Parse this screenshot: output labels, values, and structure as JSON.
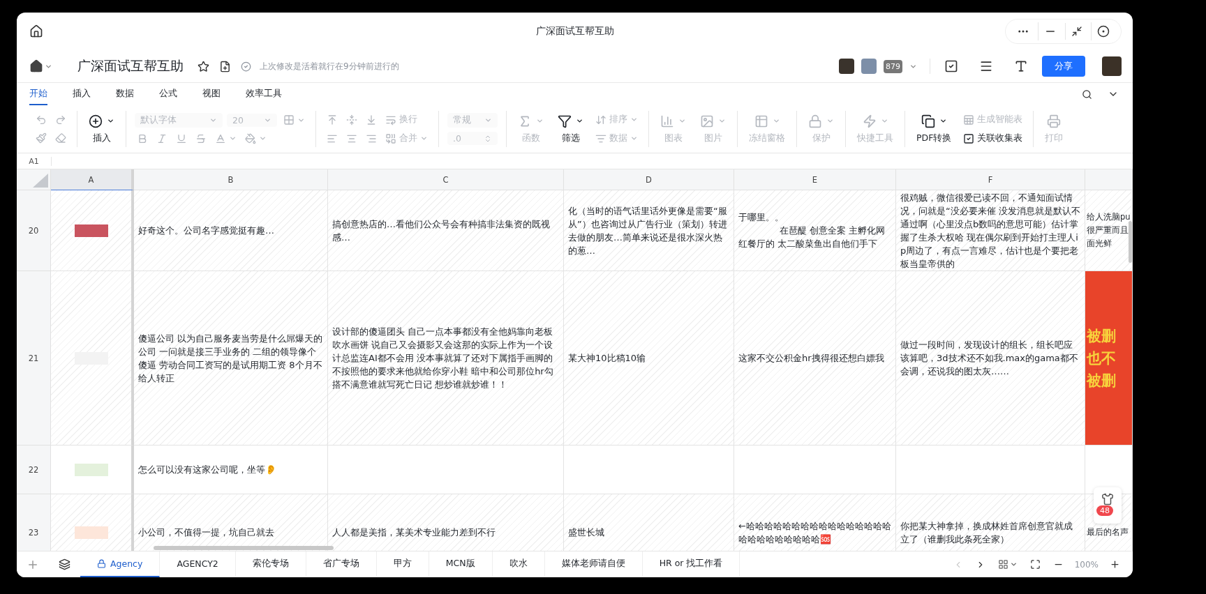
{
  "window": {
    "title": "广深面试互帮互助"
  },
  "header": {
    "doc_title": "广深面试互帮互助",
    "last_edit": "上次修改是活着就行在9分钟前进行的",
    "collaborator_count": "879",
    "share": "分享"
  },
  "menu_tabs": [
    {
      "label": "开始",
      "selected": true
    },
    {
      "label": "插入",
      "selected": false
    },
    {
      "label": "数据",
      "selected": false
    },
    {
      "label": "公式",
      "selected": false
    },
    {
      "label": "视图",
      "selected": false
    },
    {
      "label": "效率工具",
      "selected": false
    }
  ],
  "ribbon": [
    [
      {
        "rows": [
          [
            {
              "kind": "undo",
              "disabled": true
            },
            {
              "kind": "redo",
              "disabled": true
            }
          ],
          [
            {
              "kind": "painter",
              "disabled": true
            },
            {
              "kind": "eraser",
              "disabled": true
            }
          ]
        ]
      }
    ],
    [
      {
        "items": [
          {
            "kind": "insert",
            "label": "插入",
            "dropdown": true,
            "disabled": false
          }
        ]
      }
    ],
    [
      {
        "rows": [
          [
            {
              "kind": "select",
              "value": "默认字体",
              "disabled": true
            },
            {
              "kind": "select",
              "value": "20",
              "disabled": true
            },
            {
              "kind": "borders",
              "dropdown": true,
              "disabled": true
            }
          ],
          [
            {
              "kind": "bold",
              "disabled": true
            },
            {
              "kind": "italic",
              "disabled": true
            },
            {
              "kind": "underline",
              "disabled": true
            },
            {
              "kind": "strike",
              "disabled": true
            },
            {
              "kind": "font_color",
              "dropdown": true,
              "disabled": true
            },
            {
              "kind": "fill_color",
              "dropdown": true,
              "disabled": true
            }
          ]
        ]
      }
    ],
    [
      {
        "rows": [
          [
            {
              "kind": "align_top",
              "disabled": true
            },
            {
              "kind": "align_middle",
              "disabled": true
            },
            {
              "kind": "align_bottom",
              "disabled": true
            },
            {
              "kind": "wrap",
              "label": "换行",
              "disabled": true
            }
          ],
          [
            {
              "kind": "align_left",
              "disabled": true
            },
            {
              "kind": "align_center",
              "disabled": true
            },
            {
              "kind": "align_right",
              "disabled": true
            },
            {
              "kind": "merge",
              "label": "合并",
              "dropdown": true,
              "disabled": true
            }
          ]
        ]
      }
    ],
    [
      {
        "rows": [
          [
            {
              "kind": "select",
              "value": "常规",
              "disabled": true
            }
          ],
          [
            {
              "kind": "decimal",
              "value": ".0",
              "disabled": true
            }
          ]
        ]
      }
    ],
    [
      {
        "items": [
          {
            "kind": "sum",
            "label": "函数",
            "dropdown": true,
            "disabled": true
          },
          {
            "kind": "filter",
            "label": "筛选",
            "dropdown": true,
            "disabled": false
          }
        ]
      },
      {
        "rows": [
          [
            {
              "kind": "sort",
              "label": "排序",
              "dropdown": true,
              "disabled": true
            }
          ],
          [
            {
              "kind": "data",
              "label": "数据",
              "dropdown": true,
              "disabled": true
            }
          ]
        ]
      }
    ],
    [
      {
        "items": [
          {
            "kind": "chart",
            "label": "图表",
            "dropdown": true,
            "disabled": true
          },
          {
            "kind": "image",
            "label": "图片",
            "dropdown": true,
            "disabled": true
          }
        ]
      }
    ],
    [
      {
        "items": [
          {
            "kind": "freeze",
            "label": "冻结窗格",
            "dropdown": true,
            "disabled": true
          }
        ]
      }
    ],
    [
      {
        "items": [
          {
            "kind": "protect",
            "label": "保护",
            "dropdown": true,
            "disabled": true
          }
        ]
      }
    ],
    [
      {
        "items": [
          {
            "kind": "quick",
            "label": "快捷工具",
            "dropdown": true,
            "disabled": true
          }
        ]
      }
    ],
    [
      {
        "items": [
          {
            "kind": "pdf",
            "label": "PDF转换",
            "dropdown": true,
            "disabled": false
          }
        ]
      },
      {
        "rows": [
          [
            {
              "kind": "smart",
              "label": "生成智能表",
              "disabled": true
            }
          ],
          [
            {
              "kind": "linked",
              "label": "关联收集表",
              "disabled": false
            }
          ]
        ]
      }
    ],
    [
      {
        "items": [
          {
            "kind": "print",
            "label": "打印",
            "disabled": true
          }
        ]
      }
    ]
  ],
  "cell_ref": "A1",
  "table": {
    "columns": [
      "A",
      "B",
      "C",
      "D",
      "E",
      "F"
    ],
    "rows": [
      {
        "number": "20",
        "striped": true,
        "color": "#c9545f",
        "alert": false,
        "cells": [
          "",
          "好奇这个。公司名字感觉挺有趣…",
          "搞创意热店的…看他们公众号会有种搞非法集资的既视感…",
          "化（当时的语气话里话外更像是需要“服从”）也咨询过从广告行业（策划）转进去做的朋友…简单来说还是很水深火热的葱…",
          [
            "于哪里。。",
            "在琶醍 创意全案 主孵化网红餐厅的 太二酸菜鱼出自他们手下"
          ],
          "很鸡贼，微信很爱已读不回，不通知面试情况，问就是“没必要来催 没发消息就是默认不通过啊（心里没点b数吗的意思可能）估计掌握了生杀大权哈 现在偶尔刷到开始打主理人ip周边了，有点一言难尽，估计也是个要把老板当皇帝供的",
          [
            "给人洗脑pu",
            "很严重而且",
            "面光鲜"
          ]
        ]
      },
      {
        "number": "21",
        "striped": true,
        "color": "#f3f3f3",
        "alert": true,
        "cells": [
          "",
          "傻逼公司 以为自己服务麦当劳是什么屌爆天的公司 一问就是接三手业务的 二组的领导像个傻逼 劳动合同工资写的是试用期工资 8个月不给人转正",
          "设计部的傻逼团头 自己一点本事都没有全他妈靠向老板吹水画饼  说自己又会摄影又会这那的实际上作为一个设计总监连AI都不会用  没本事就算了还对下属指手画脚的不按照他的要求来他就给你穿小鞋  暗中和公司那位hr勾搭不满意谁就写死亡日记  想炒谁就炒谁！！",
          "某大神10比稿10输",
          "这家不交公积金hr拽得很还想白嫖我",
          "做过一段时间，发现设计的组长，组长吧应该算吧，3d技术还不如我.max的gama都不会调，还说我的图太灰……",
          [
            "被删",
            "也不",
            "被删"
          ]
        ]
      },
      {
        "number": "22",
        "striped": false,
        "color": "#e4f1dc",
        "alert": false,
        "cells": [
          "",
          "怎么可以没有这家公司呢，坐等👂"
        ]
      },
      {
        "number": "23",
        "striped": true,
        "color": "#fde6da",
        "alert": false,
        "cells": [
          "",
          "小公司，不值得一提，坑自己就去",
          "人人都是美指，某美术专业能力差到不行",
          "盛世长城",
          "←哈哈哈哈哈哈哈哈哈哈哈哈哈哈哈哈哈哈哈哈哈哈哈哈哈🆘",
          "你把某大神拿掉，换成林姓首席创意官就成立了（谁删我此条死全家）",
          [
            "最后的名声"
          ]
        ]
      }
    ]
  },
  "float_widget": {
    "badge": "48"
  },
  "sheet_tabs": [
    {
      "label": "Agency",
      "selected": true,
      "locked": true
    },
    {
      "label": "AGENCY2",
      "selected": false,
      "locked": false
    },
    {
      "label": "索伦专场",
      "selected": false,
      "locked": false
    },
    {
      "label": "省广专场",
      "selected": false,
      "locked": false
    },
    {
      "label": "甲方",
      "selected": false,
      "locked": false
    },
    {
      "label": "MCN版",
      "selected": false,
      "locked": false
    },
    {
      "label": "吹水",
      "selected": false,
      "locked": false
    },
    {
      "label": "媒体老师请自便",
      "selected": false,
      "locked": false
    },
    {
      "label": "HR or 找工作看",
      "selected": false,
      "locked": false
    }
  ],
  "zoom": "100%"
}
